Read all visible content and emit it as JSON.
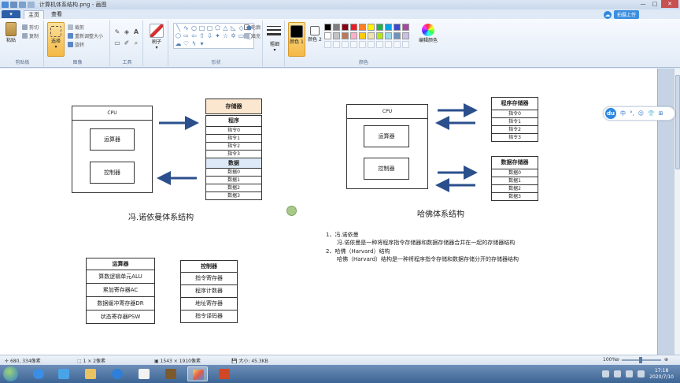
{
  "window": {
    "title": "计算机体系结构.png - 画图",
    "controls": [
      "—",
      "□",
      "✕"
    ]
  },
  "tabs": {
    "file": "▾",
    "home": "主页",
    "view": "查看"
  },
  "cloud": {
    "label": "拍摄上传"
  },
  "ribbon": {
    "clipboard": {
      "label": "剪贴板",
      "paste": "粘贴",
      "cut": "剪切",
      "copy": "复制"
    },
    "image": {
      "label": "图像",
      "select": "选择",
      "crop": "裁剪",
      "resize": "重新调整大小",
      "rotate": "旋转"
    },
    "tools": {
      "label": "工具"
    },
    "brushes": {
      "label": "刷子"
    },
    "shapes": {
      "label": "形状",
      "outline": "轮廓",
      "fill": "填充"
    },
    "size": {
      "label": "粗细"
    },
    "colors": {
      "label": "颜色",
      "color1": "颜色 1",
      "color2": "颜色 2",
      "edit": "编辑颜色",
      "color1_value": "#000000",
      "color2_value": "#ffffff",
      "palette": [
        "#000000",
        "#7f7f7f",
        "#880015",
        "#ed1c24",
        "#ff7f27",
        "#fff200",
        "#22b14c",
        "#00a2e8",
        "#3f48cc",
        "#a349a4",
        "#ffffff",
        "#c3c3c3",
        "#b97a57",
        "#ffaec9",
        "#ffc90e",
        "#efe4b0",
        "#b5e61d",
        "#99d9ea",
        "#7092be",
        "#c8bfe7"
      ]
    }
  },
  "canvas": {
    "von_neumann": {
      "cpu": "CPU",
      "alu": "运算器",
      "cu": "控制器",
      "memory_header": "存储器",
      "program_header": "程序",
      "instructions": [
        "指令0",
        "指令1",
        "指令2",
        "指令3"
      ],
      "data_header": "数据",
      "data": [
        "数据0",
        "数据1",
        "数据2",
        "数据3"
      ],
      "caption": "冯.诺依曼体系结构"
    },
    "harvard": {
      "cpu": "CPU",
      "alu": "运算器",
      "cu": "控制器",
      "program_memory": "程序存储器",
      "instructions": [
        "指令0",
        "指令1",
        "指令2",
        "指令3"
      ],
      "data_memory": "数据存储器",
      "data": [
        "数据0",
        "数据1",
        "数据2",
        "数据3"
      ],
      "caption": "哈佛体系结构"
    },
    "notes": [
      "1、冯.诺依曼",
      "冯.诺依曼是一种将程序指令存储器和数据存储器合并在一起的存储器结构",
      "2、哈佛（Harvard）结构",
      "哈佛（Harvard）结构是一种将程序指令存储和数据存储分开的存储器结构"
    ],
    "alu_table": {
      "header": "运算器",
      "rows": [
        "算数逻辑单元ALU",
        "累加寄存器AC",
        "数据缓冲寄存器DR",
        "状态寄存器PSW"
      ]
    },
    "cu_table": {
      "header": "控制器",
      "rows": [
        "指令寄存器",
        "程序计数器",
        "地址寄存器",
        "指令译码器"
      ]
    }
  },
  "dubar": {
    "logo": "du",
    "items": [
      "中",
      "°,",
      "☺",
      "👕",
      "⊞"
    ]
  },
  "status": {
    "cursor": "680, 334像素",
    "selection": "1 × 2像素",
    "dimensions": "1543 × 1910像素",
    "filesize": "大小: 45.3KB",
    "zoom": "100%"
  },
  "taskbar": {
    "time": "17:18",
    "date": "2020/7/10"
  }
}
